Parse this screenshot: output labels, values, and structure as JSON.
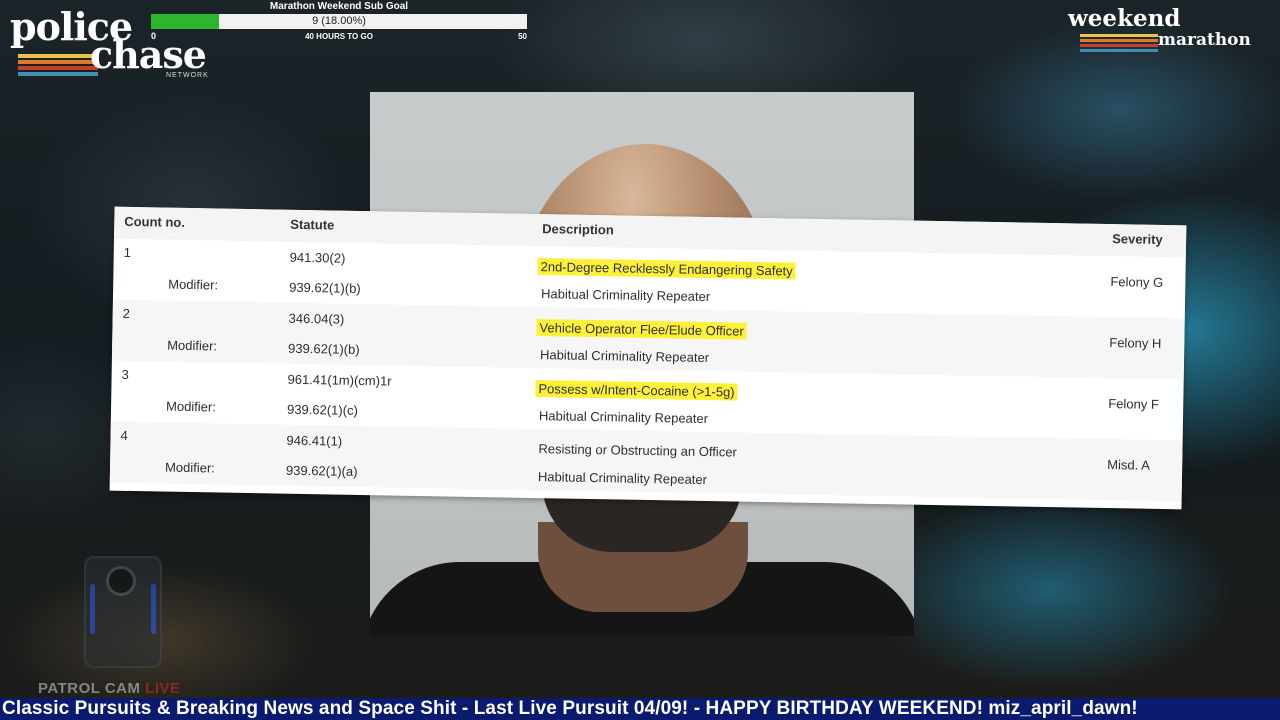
{
  "brand": {
    "line1": "police",
    "line2": "chase",
    "network": "NETWORK",
    "stripe_colors": [
      "#e8c24a",
      "#e07a2b",
      "#c63d2a",
      "#3f8fb0"
    ]
  },
  "sub_goal": {
    "title": "Marathon Weekend Sub Goal",
    "value_text": "9 (18.00%)",
    "progress_fraction": 0.18,
    "min": "0",
    "max": "50",
    "subtitle": "40 HOURS TO GO",
    "fill_color": "#2db52d"
  },
  "event_logo": {
    "line1": "weekend",
    "line2": "marathon",
    "stripe_colors": [
      "#e8c24a",
      "#e07a2b",
      "#c63d2a",
      "#3f8fb0"
    ]
  },
  "charges": {
    "headers": {
      "count": "Count no.",
      "statute": "Statute",
      "description": "Description",
      "severity": "Severity"
    },
    "rows": [
      {
        "count": "1",
        "statute": "941.30(2)",
        "description": "2nd-Degree Recklessly Endangering Safety",
        "highlighted": true,
        "modifier_label": "Modifier:",
        "modifier_statute": "939.62(1)(b)",
        "modifier_description": "Habitual Criminality Repeater",
        "severity": "Felony G"
      },
      {
        "count": "2",
        "statute": "346.04(3)",
        "description": "Vehicle Operator Flee/Elude Officer",
        "highlighted": true,
        "modifier_label": "Modifier:",
        "modifier_statute": "939.62(1)(b)",
        "modifier_description": "Habitual Criminality Repeater",
        "severity": "Felony H"
      },
      {
        "count": "3",
        "statute": "961.41(1m)(cm)1r",
        "description": "Possess w/Intent-Cocaine (>1-5g)",
        "highlighted": true,
        "modifier_label": "Modifier:",
        "modifier_statute": "939.62(1)(c)",
        "modifier_description": "Habitual Criminality Repeater",
        "severity": "Felony F"
      },
      {
        "count": "4",
        "statute": "946.41(1)",
        "description": "Resisting or Obstructing an Officer",
        "highlighted": false,
        "modifier_label": "Modifier:",
        "modifier_statute": "939.62(1)(a)",
        "modifier_description": "Habitual Criminality Repeater",
        "severity": "Misd. A"
      }
    ],
    "highlight_color": "#fff13a"
  },
  "patrol_cam": {
    "label": "PATROL CAM",
    "live": "LIVE"
  },
  "ticker": {
    "text": "Classic Pursuits & Breaking News and Space Shit - Last Live Pursuit 04/09! - HAPPY BIRTHDAY WEEKEND! miz_april_dawn!",
    "background": "#0a1a6e"
  }
}
